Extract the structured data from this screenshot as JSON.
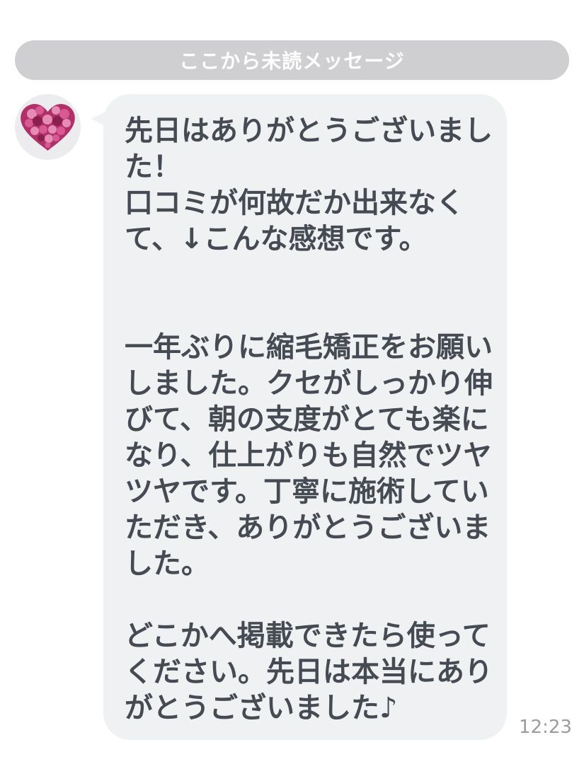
{
  "divider": {
    "label": "ここから未読メッセージ"
  },
  "message": {
    "lines": [
      "先日はありがとうございまし",
      "た！",
      "口コミが何故だか出来なく",
      "て、↓こんな感想です。",
      "",
      "",
      "一年ぶりに縮毛矯正をお願い",
      "しました。クセがしっかり伸",
      "びて、朝の支度がとても楽に",
      "なり、仕上がりも自然でツヤ",
      "ツヤです。丁寧に施術してい",
      "ただき、ありがとうございま",
      "した。",
      "",
      "どこかへ掲載できたら使って",
      "ください。先日は本当にあり",
      "がとうございました♪"
    ],
    "time": "12:23"
  },
  "avatar": {
    "icon": "heart-flower-icon",
    "colors": [
      "#b0306a",
      "#d85a92",
      "#8a1f4e",
      "#e68cb4"
    ]
  }
}
